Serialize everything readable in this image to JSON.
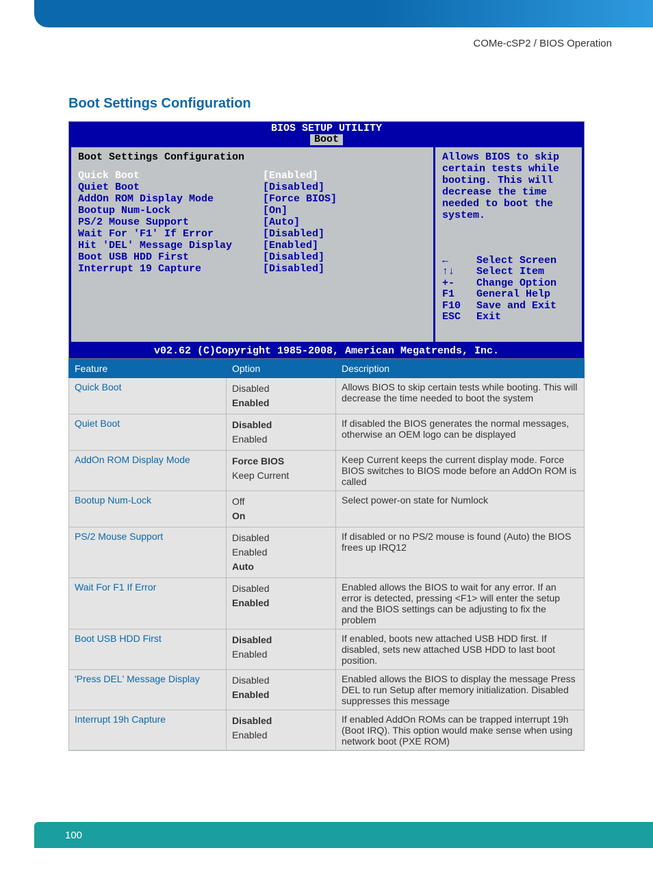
{
  "header": {
    "breadcrumb": "COMe-cSP2 / BIOS Operation"
  },
  "section": {
    "title": "Boot Settings Configuration"
  },
  "bios": {
    "title": "BIOS SETUP UTILITY",
    "tab": "Boot",
    "panel_title": "Boot Settings Configuration",
    "items": [
      {
        "label": "Quick Boot",
        "value": "[Enabled]",
        "selected": true
      },
      {
        "label": "Quiet Boot",
        "value": "[Disabled]",
        "selected": false
      },
      {
        "label": "AddOn ROM Display Mode",
        "value": "[Force BIOS]",
        "selected": false
      },
      {
        "label": "Bootup Num-Lock",
        "value": "[On]",
        "selected": false
      },
      {
        "label": "PS/2 Mouse Support",
        "value": "[Auto]",
        "selected": false
      },
      {
        "label": "Wait For 'F1' If Error",
        "value": "[Disabled]",
        "selected": false
      },
      {
        "label": "Hit 'DEL' Message Display",
        "value": "[Enabled]",
        "selected": false
      },
      {
        "label": "Boot USB HDD First",
        "value": "[Disabled]",
        "selected": false
      },
      {
        "label": "Interrupt 19 Capture",
        "value": "[Disabled]",
        "selected": false
      }
    ],
    "help_text": "Allows BIOS to skip certain tests while booting. This will decrease the time needed to boot the system.",
    "keys": [
      {
        "key": "←",
        "action": "Select Screen"
      },
      {
        "key": "↑↓",
        "action": "Select Item"
      },
      {
        "key": "+-",
        "action": "Change Option"
      },
      {
        "key": "F1",
        "action": "General Help"
      },
      {
        "key": "F10",
        "action": "Save and Exit"
      },
      {
        "key": "ESC",
        "action": "Exit"
      }
    ],
    "copyright": "v02.62 (C)Copyright 1985-2008, American Megatrends, Inc."
  },
  "table": {
    "headers": {
      "feature": "Feature",
      "option": "Option",
      "description": "Description"
    },
    "rows": [
      {
        "feature": "Quick Boot",
        "options": [
          {
            "text": "Disabled",
            "default": false
          },
          {
            "text": "Enabled",
            "default": true
          }
        ],
        "description": "Allows BIOS to skip certain tests while booting. This will decrease the time needed to boot the system"
      },
      {
        "feature": "Quiet Boot",
        "options": [
          {
            "text": "Disabled",
            "default": true
          },
          {
            "text": "Enabled",
            "default": false
          }
        ],
        "description": "If disabled the BIOS generates the normal messages, otherwise an OEM logo can be displayed"
      },
      {
        "feature": "AddOn ROM Display Mode",
        "options": [
          {
            "text": "Force BIOS",
            "default": true
          },
          {
            "text": "Keep Current",
            "default": false
          }
        ],
        "description": "Keep Current keeps the current display mode. Force BIOS switches to BIOS mode before an AddOn ROM is called"
      },
      {
        "feature": "Bootup Num-Lock",
        "options": [
          {
            "text": "Off",
            "default": false
          },
          {
            "text": "On",
            "default": true
          }
        ],
        "description": "Select power-on state for Numlock"
      },
      {
        "feature": "PS/2 Mouse Support",
        "options": [
          {
            "text": "Disabled",
            "default": false
          },
          {
            "text": "Enabled",
            "default": false
          },
          {
            "text": "Auto",
            "default": true
          }
        ],
        "description": "If disabled or no PS/2 mouse is found (Auto) the BIOS frees up IRQ12"
      },
      {
        "feature": "Wait For F1 If Error",
        "options": [
          {
            "text": "Disabled",
            "default": false
          },
          {
            "text": "Enabled",
            "default": true
          }
        ],
        "description": "Enabled allows the BIOS to wait for any error. If an error is detected, pressing <F1> will enter the setup and the BIOS settings can be adjusting to fix the problem"
      },
      {
        "feature": "Boot USB HDD First",
        "options": [
          {
            "text": "Disabled",
            "default": true
          },
          {
            "text": "Enabled",
            "default": false
          }
        ],
        "description": "If enabled, boots new attached USB HDD first. If disabled, sets new attached USB HDD to last boot position."
      },
      {
        "feature": "'Press DEL' Message Display",
        "options": [
          {
            "text": "Disabled",
            "default": false
          },
          {
            "text": "Enabled",
            "default": true
          }
        ],
        "description": "Enabled allows the BIOS to display the message Press DEL to run Setup after memory initialization. Disabled suppresses this message"
      },
      {
        "feature": "Interrupt 19h Capture",
        "options": [
          {
            "text": "Disabled",
            "default": true
          },
          {
            "text": "Enabled",
            "default": false
          }
        ],
        "description": "If enabled AddOn ROMs can be trapped interrupt 19h (Boot IRQ). This option would make sense when using network boot (PXE ROM)"
      }
    ]
  },
  "footer": {
    "page_number": "100"
  }
}
